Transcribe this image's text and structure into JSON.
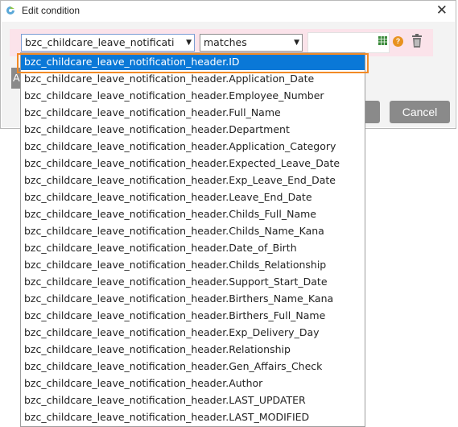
{
  "window": {
    "title": "Edit condition",
    "close_symbol": "✕"
  },
  "condition": {
    "field_value": "bzc_childcare_leave_notificati",
    "operator_value": "matches",
    "value_input": "",
    "arrow_symbol": "▼"
  },
  "buttons": {
    "partial_left_label": "A",
    "cancel_label": "Cancel"
  },
  "icons": {
    "help_symbol": "?"
  },
  "colors": {
    "selected_bg": "#0a78d7",
    "outline": "#f28a25",
    "row_bg": "#fbe3ea"
  },
  "dropdown": {
    "selected_index": 0,
    "options": [
      "bzc_childcare_leave_notification_header.ID",
      "bzc_childcare_leave_notification_header.Application_Date",
      "bzc_childcare_leave_notification_header.Employee_Number",
      "bzc_childcare_leave_notification_header.Full_Name",
      "bzc_childcare_leave_notification_header.Department",
      "bzc_childcare_leave_notification_header.Application_Category",
      "bzc_childcare_leave_notification_header.Expected_Leave_Date",
      "bzc_childcare_leave_notification_header.Exp_Leave_End_Date",
      "bzc_childcare_leave_notification_header.Leave_End_Date",
      "bzc_childcare_leave_notification_header.Childs_Full_Name",
      "bzc_childcare_leave_notification_header.Childs_Name_Kana",
      "bzc_childcare_leave_notification_header.Date_of_Birth",
      "bzc_childcare_leave_notification_header.Childs_Relationship",
      "bzc_childcare_leave_notification_header.Support_Start_Date",
      "bzc_childcare_leave_notification_header.Birthers_Name_Kana",
      "bzc_childcare_leave_notification_header.Birthers_Full_Name",
      "bzc_childcare_leave_notification_header.Exp_Delivery_Day",
      "bzc_childcare_leave_notification_header.Relationship",
      "bzc_childcare_leave_notification_header.Gen_Affairs_Check",
      "bzc_childcare_leave_notification_header.Author",
      "bzc_childcare_leave_notification_header.LAST_UPDATER",
      "bzc_childcare_leave_notification_header.LAST_MODIFIED"
    ]
  }
}
